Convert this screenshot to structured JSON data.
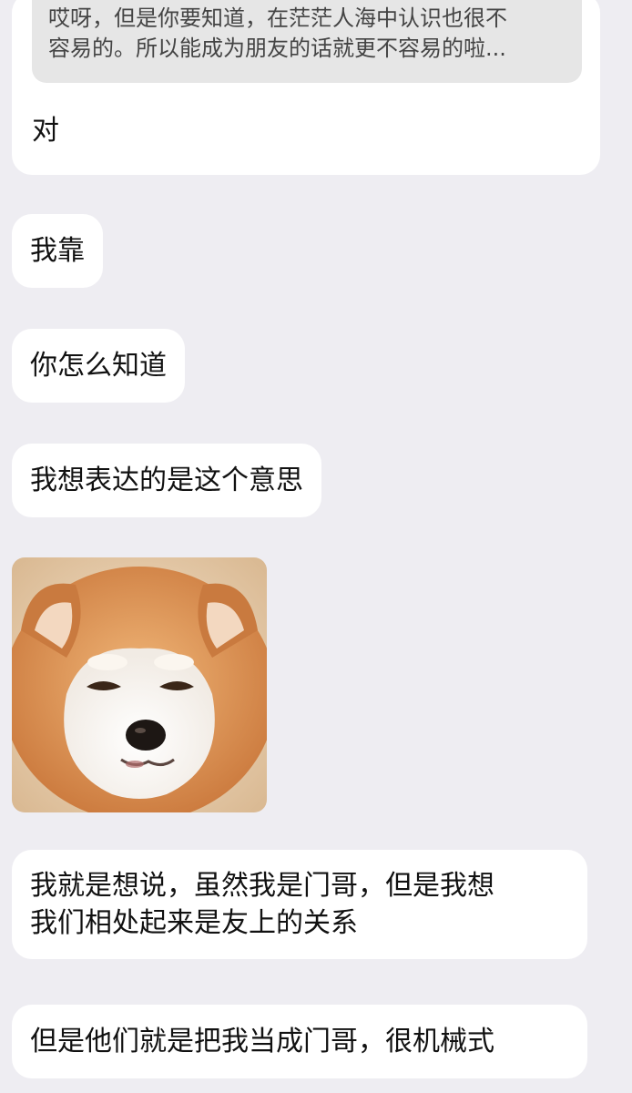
{
  "messages": {
    "first": {
      "quote_line_1": "哎呀，但是你要知道，在茫茫人海中认识也很不",
      "quote_line_2": "容易的。所以能成为朋友的话就更不容易的啦...",
      "text": "对"
    },
    "m2": "我靠",
    "m3": "你怎么知道",
    "m4": "我想表达的是这个意思",
    "sticker": {
      "subject": "shiba-dog-sticker"
    },
    "m5": {
      "line_1": "我就是想说，虽然我是门哥，但是我想",
      "line_2": "我们相处起来是友上的关系"
    },
    "m6": "但是他们就是把我当成门哥，很机械式"
  },
  "colors": {
    "background": "#eeedf2",
    "bubble": "#ffffff",
    "quote": "#e6e6e6",
    "text": "#111111"
  }
}
